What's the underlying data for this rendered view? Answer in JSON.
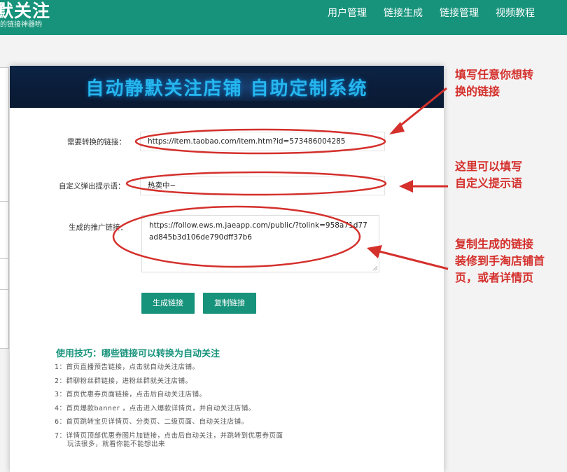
{
  "header": {
    "logo_title": "默关注",
    "logo_subtitle": "的链接神器哟",
    "nav": [
      "用户管理",
      "链接生成",
      "链接管理",
      "视频教程"
    ]
  },
  "banner": {
    "title": "自动静默关注店铺 自助定制系统"
  },
  "form": {
    "link_label": "需要转换的链接：",
    "link_value": "https://item.taobao.com/item.htm?id=573486004285",
    "tip_label": "自定义弹出提示语：",
    "tip_value": "热卖中~",
    "result_label": "生成的推广链接：",
    "result_value": "https://follow.ews.m.jaeapp.com/public/?tolink=958a71d77ad845b3d106de790dff37b6",
    "generate_button": "生成链接",
    "copy_button": "复制链接"
  },
  "tips": {
    "title": "使用技巧：哪些链接可以转换为自动关注",
    "items": [
      "1：首页直播预告链接，点击就自动关注店铺。",
      "2：群聊粉丝群链接，进粉丝群就关注店铺。",
      "3：首页优惠券页面链接，点击后自动关注店铺。",
      "4：首页爆款banner ，点击进入爆款详情页，并自动关注店铺。",
      "6：首页跳转宝贝详情页、分类页、二级页面、自动关注店铺。",
      "7：详情页顶部优惠券图片加链接，点击后自动关注，并跳转到优惠券页面"
    ],
    "footer": "玩法很多，就看你能不能想出来"
  },
  "annotations": {
    "a1_line1": "填写任意你想转",
    "a1_line2": "换的链接",
    "a2_line1": "这里可以填写",
    "a2_line2": "自定义提示语",
    "a3_line1": "复制生成的链接",
    "a3_line2": "装修到手淘店铺首",
    "a3_line3": "页，或者详情页"
  },
  "colors": {
    "brand": "#17937b",
    "annotation": "#d4302c",
    "banner_bg": "#0d2444",
    "banner_text": "#26b6ee"
  }
}
